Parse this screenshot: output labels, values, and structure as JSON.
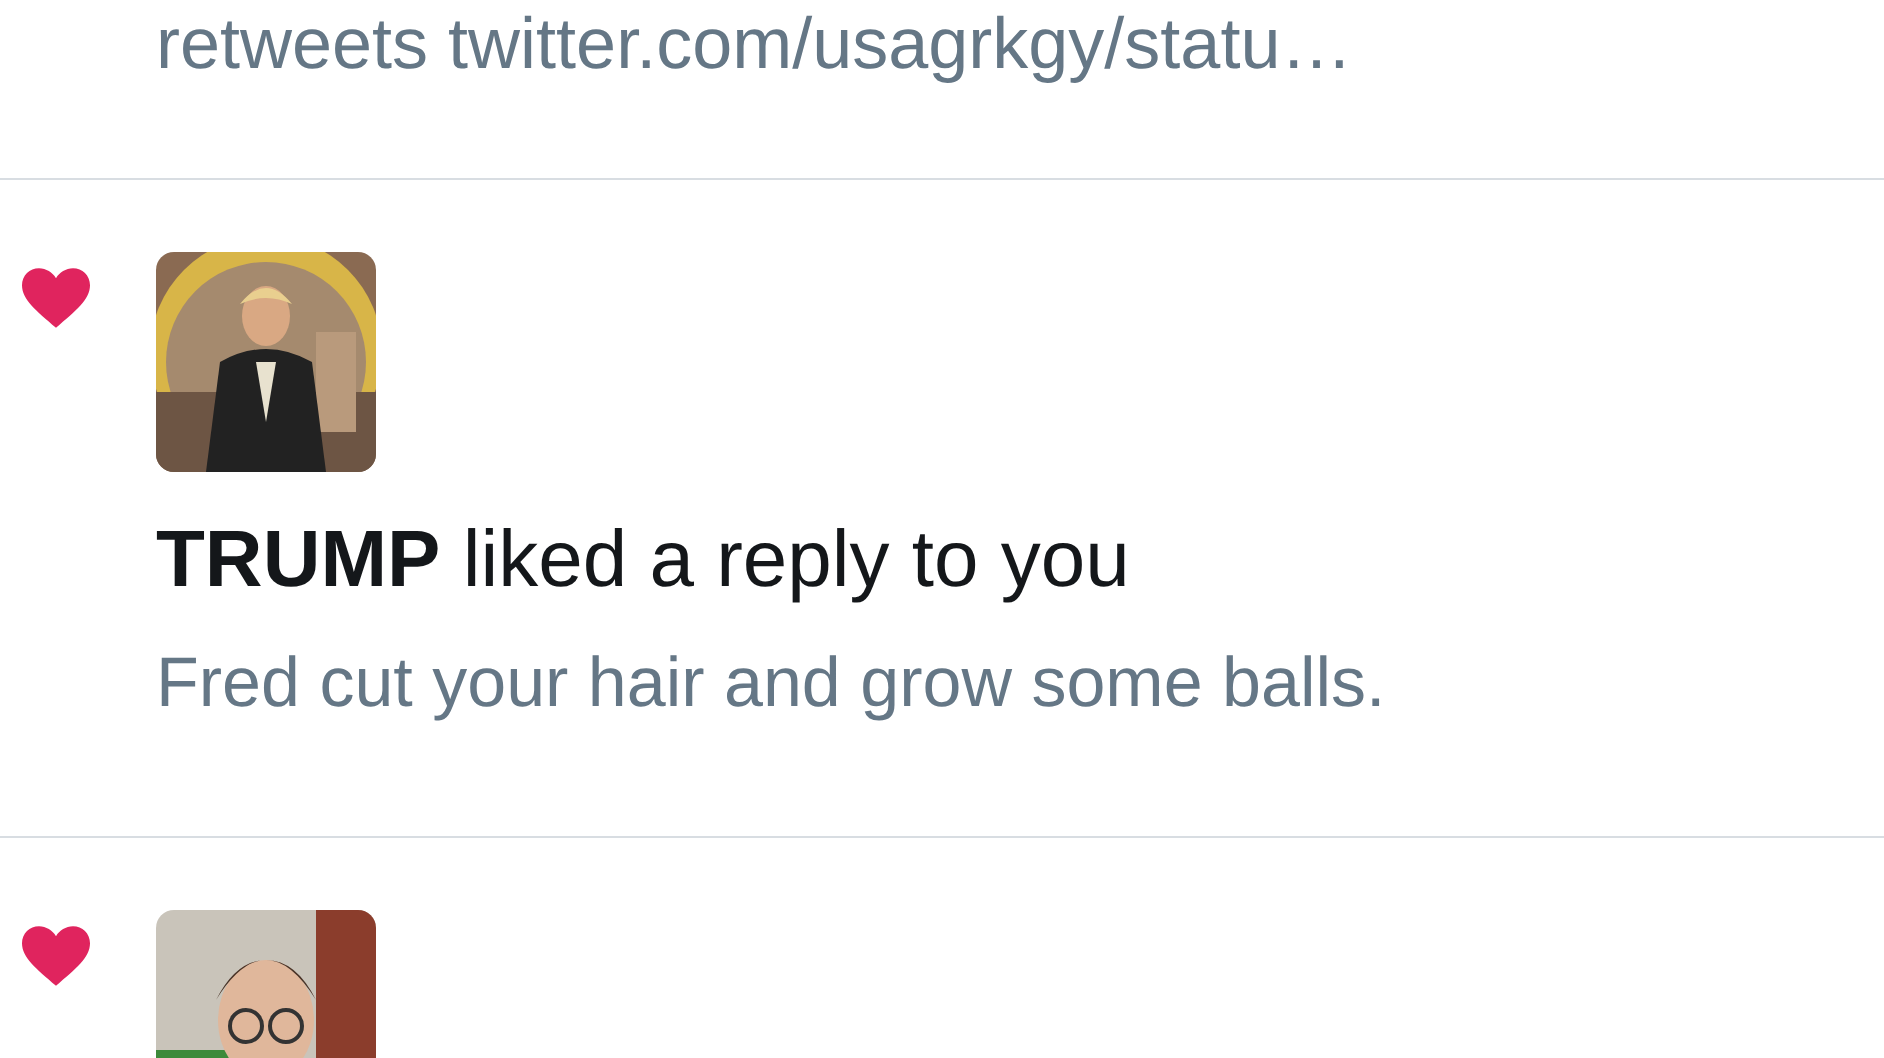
{
  "top_item": {
    "text": "retweets twitter.com/usagrkgy/statu…"
  },
  "notifications": [
    {
      "kind": "like",
      "title": "**TRUMP** liked a reply to you",
      "body": "Fred cut your hair and grow some balls."
    },
    {
      "kind": "like"
    }
  ]
}
